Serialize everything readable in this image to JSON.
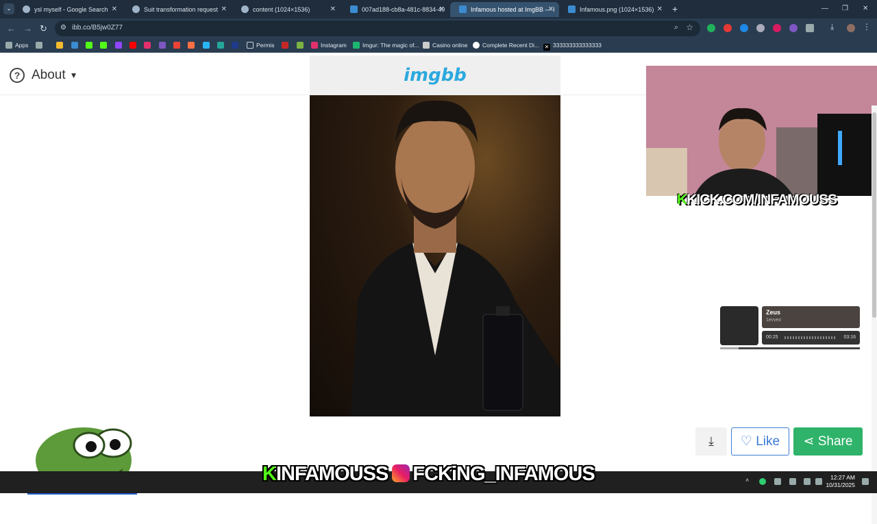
{
  "tabs": [
    {
      "label": "ysl myself - Google Search",
      "close": "✕"
    },
    {
      "label": "Suit transformation request",
      "close": "✕"
    },
    {
      "label": "content (1024×1536)",
      "close": "✕"
    },
    {
      "label": "007ad188-cb8a-481c-8834-40",
      "close": "✕"
    },
    {
      "label": "Infamous hosted at ImgBB — I",
      "close": "✕"
    },
    {
      "label": "Infamous.png (1024×1536)",
      "close": "✕"
    }
  ],
  "new_tab": "+",
  "address": {
    "url": "ibb.co/B5jw0Z77"
  },
  "bookmarks": {
    "apps": "Apps",
    "permis": "Permis",
    "instagram": "Instagram",
    "imgur": "Imgur: The magic of...",
    "casino": "Casino online",
    "complete": "Complete Recent Di...",
    "x": "333333333333333"
  },
  "page": {
    "about_label": "About",
    "logo": "imgbb"
  },
  "stream": {
    "kick_url": "KICK.COM/INFAMOUSS",
    "kick_k": "K",
    "overlay_name": "INFAMOUSS",
    "overlay_k": "K",
    "overlay_ig": "FCKiNG_INFAMOUS"
  },
  "music": {
    "title": "Zeus",
    "artist": "1evvez",
    "elapsed": "00:25",
    "total": "03:16",
    "progress": 0.13
  },
  "actions": {
    "like": "Like",
    "share": "Share"
  },
  "clock": {
    "time": "12:27 AM",
    "date": "10/31/2025"
  },
  "colors": {
    "kick_green": "#53fc18",
    "imgbb_blue": "#2ca9de",
    "share_green": "#2fb36a",
    "like_blue": "#3a7bd5"
  }
}
